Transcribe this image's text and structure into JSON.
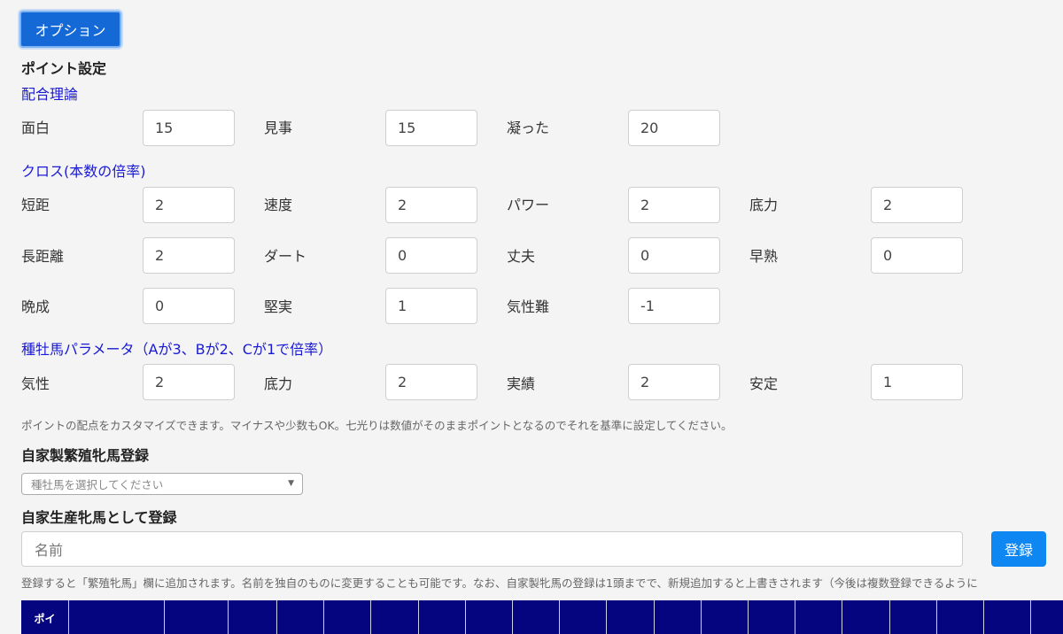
{
  "option_button": "オプション",
  "point_settings": {
    "title": "ポイント設定",
    "haigo": {
      "heading": "配合理論",
      "fields": [
        {
          "label": "面白",
          "value": "15"
        },
        {
          "label": "見事",
          "value": "15"
        },
        {
          "label": "凝った",
          "value": "20"
        }
      ]
    },
    "cross": {
      "heading": "クロス(本数の倍率)",
      "fields": [
        {
          "label": "短距",
          "value": "2"
        },
        {
          "label": "速度",
          "value": "2"
        },
        {
          "label": "パワー",
          "value": "2"
        },
        {
          "label": "底力",
          "value": "2"
        },
        {
          "label": "長距離",
          "value": "2"
        },
        {
          "label": "ダート",
          "value": "0"
        },
        {
          "label": "丈夫",
          "value": "0"
        },
        {
          "label": "早熟",
          "value": "0"
        },
        {
          "label": "晩成",
          "value": "0"
        },
        {
          "label": "堅実",
          "value": "1"
        },
        {
          "label": "気性難",
          "value": "-1"
        }
      ]
    },
    "stallion_params": {
      "heading": "種牡馬パラメータ（Aが3、Bが2、Cが1で倍率）",
      "fields": [
        {
          "label": "気性",
          "value": "2"
        },
        {
          "label": "底力",
          "value": "2"
        },
        {
          "label": "実績",
          "value": "2"
        },
        {
          "label": "安定",
          "value": "1"
        }
      ]
    },
    "note": "ポイントの配点をカスタマイズできます。マイナスや少数もOK。七光りは数値がそのままポイントとなるのでそれを基準に設定してください。"
  },
  "home_breeding": {
    "title": "自家製繁殖牝馬登録",
    "select_placeholder": "種牡馬を選択してください"
  },
  "home_produced": {
    "title": "自家生産牝馬として登録",
    "name_placeholder": "名前",
    "register_button": "登録",
    "note": "登録すると「繁殖牝馬」欄に追加されます。名前を独自のものに変更することも可能です。なお、自家製牝馬の登録は1頭までで、新規追加すると上書きされます（今後は複数登録できるように"
  },
  "table": {
    "first_header": "ポイ"
  }
}
